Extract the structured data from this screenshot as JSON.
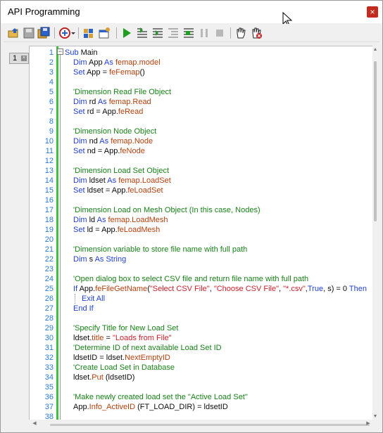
{
  "window": {
    "title": "API Programming",
    "close_label": "×"
  },
  "toolbar": {
    "buttons": [
      "open-icon",
      "save-icon",
      "save-all-icon",
      "reference-icon",
      "dropdown-arrow-icon",
      "build-icon",
      "references-icon",
      "run-icon",
      "step-into-icon",
      "step-over-icon",
      "step-out-icon",
      "run-to-cursor-icon",
      "pause-icon",
      "stop-icon",
      "grab-icon",
      "stop-grab-icon"
    ]
  },
  "tabs": [
    {
      "label": "1",
      "close_label": "×"
    }
  ],
  "editor": {
    "lines": [
      {
        "n": "1",
        "indent": 0,
        "parts": [
          [
            "kw",
            "Sub "
          ],
          [
            "pl",
            "Main"
          ]
        ]
      },
      {
        "n": "2",
        "indent": 1,
        "parts": [
          [
            "kw",
            "Dim "
          ],
          [
            "pl",
            "App "
          ],
          [
            "kw",
            "As "
          ],
          [
            "ob",
            "femap.model"
          ]
        ]
      },
      {
        "n": "3",
        "indent": 1,
        "parts": [
          [
            "kw",
            "Set "
          ],
          [
            "pl",
            "App = "
          ],
          [
            "fn",
            "feFemap"
          ],
          [
            "pl",
            "()"
          ]
        ]
      },
      {
        "n": "4",
        "indent": 0,
        "parts": []
      },
      {
        "n": "5",
        "indent": 1,
        "parts": [
          [
            "cm",
            "'Dimension Read File Object"
          ]
        ]
      },
      {
        "n": "6",
        "indent": 1,
        "parts": [
          [
            "kw",
            "Dim "
          ],
          [
            "pl",
            "rd "
          ],
          [
            "kw",
            "As "
          ],
          [
            "ob",
            "femap.Read"
          ]
        ]
      },
      {
        "n": "7",
        "indent": 1,
        "parts": [
          [
            "kw",
            "Set "
          ],
          [
            "pl",
            "rd = App."
          ],
          [
            "fn",
            "feRead"
          ]
        ]
      },
      {
        "n": "8",
        "indent": 0,
        "parts": []
      },
      {
        "n": "9",
        "indent": 1,
        "parts": [
          [
            "cm",
            "'Dimension Node Object"
          ]
        ]
      },
      {
        "n": "10",
        "indent": 1,
        "parts": [
          [
            "kw",
            "Dim "
          ],
          [
            "pl",
            "nd "
          ],
          [
            "kw",
            "As "
          ],
          [
            "ob",
            "femap.Node"
          ]
        ]
      },
      {
        "n": "11",
        "indent": 1,
        "parts": [
          [
            "kw",
            "Set "
          ],
          [
            "pl",
            "nd = App."
          ],
          [
            "fn",
            "feNode"
          ]
        ]
      },
      {
        "n": "12",
        "indent": 0,
        "parts": []
      },
      {
        "n": "13",
        "indent": 1,
        "parts": [
          [
            "cm",
            "'Dimension Load Set Object"
          ]
        ]
      },
      {
        "n": "14",
        "indent": 1,
        "parts": [
          [
            "kw",
            "Dim "
          ],
          [
            "pl",
            "ldset "
          ],
          [
            "kw",
            "As "
          ],
          [
            "ob",
            "femap.LoadSet"
          ]
        ]
      },
      {
        "n": "15",
        "indent": 1,
        "parts": [
          [
            "kw",
            "Set "
          ],
          [
            "pl",
            "ldset = App."
          ],
          [
            "fn",
            "feLoadSet"
          ]
        ]
      },
      {
        "n": "16",
        "indent": 0,
        "parts": []
      },
      {
        "n": "17",
        "indent": 1,
        "parts": [
          [
            "cm",
            "'Dimension Load on Mesh Object (In this case, Nodes)"
          ]
        ]
      },
      {
        "n": "18",
        "indent": 1,
        "parts": [
          [
            "kw",
            "Dim "
          ],
          [
            "pl",
            "ld "
          ],
          [
            "kw",
            "As "
          ],
          [
            "ob",
            "femap.LoadMesh"
          ]
        ]
      },
      {
        "n": "19",
        "indent": 1,
        "parts": [
          [
            "kw",
            "Set "
          ],
          [
            "pl",
            "ld = App."
          ],
          [
            "fn",
            "feLoadMesh"
          ]
        ]
      },
      {
        "n": "20",
        "indent": 0,
        "parts": []
      },
      {
        "n": "21",
        "indent": 1,
        "parts": [
          [
            "cm",
            "'Dimension variable to store file name with full path"
          ]
        ]
      },
      {
        "n": "22",
        "indent": 1,
        "parts": [
          [
            "kw",
            "Dim "
          ],
          [
            "pl",
            "s "
          ],
          [
            "kw",
            "As String"
          ]
        ]
      },
      {
        "n": "23",
        "indent": 0,
        "parts": []
      },
      {
        "n": "24",
        "indent": 1,
        "parts": [
          [
            "cm",
            "'Open dialog box to select CSV file and return file name with full path"
          ]
        ]
      },
      {
        "n": "25",
        "indent": 1,
        "parts": [
          [
            "kw",
            "If "
          ],
          [
            "pl",
            "App."
          ],
          [
            "fn",
            "feFileGetName"
          ],
          [
            "pl",
            "("
          ],
          [
            "st",
            "\"Select CSV File\""
          ],
          [
            "pl",
            ", "
          ],
          [
            "st",
            "\"Choose CSV File\""
          ],
          [
            "pl",
            ", "
          ],
          [
            "st",
            "\"*.csv\""
          ],
          [
            "pl",
            ","
          ],
          [
            "kw",
            "True"
          ],
          [
            "pl",
            ", s) = 0 "
          ],
          [
            "kw",
            "Then"
          ]
        ]
      },
      {
        "n": "26",
        "indent": 2,
        "parts": [
          [
            "kw",
            "Exit All"
          ]
        ]
      },
      {
        "n": "27",
        "indent": 1,
        "parts": [
          [
            "kw",
            "End If"
          ]
        ]
      },
      {
        "n": "28",
        "indent": 0,
        "parts": []
      },
      {
        "n": "29",
        "indent": 1,
        "parts": [
          [
            "cm",
            "'Specify Title for New Load Set"
          ]
        ]
      },
      {
        "n": "30",
        "indent": 1,
        "parts": [
          [
            "pl",
            "ldset."
          ],
          [
            "fn",
            "title"
          ],
          [
            "pl",
            " = "
          ],
          [
            "st",
            "\"Loads from File\""
          ]
        ]
      },
      {
        "n": "31",
        "indent": 1,
        "parts": [
          [
            "cm",
            "'Determine ID of next available Load Set ID"
          ]
        ]
      },
      {
        "n": "32",
        "indent": 1,
        "parts": [
          [
            "pl",
            "ldsetID = ldset."
          ],
          [
            "fn",
            "NextEmptyID"
          ]
        ]
      },
      {
        "n": "33",
        "indent": 1,
        "parts": [
          [
            "cm",
            "'Create Load Set in Database"
          ]
        ]
      },
      {
        "n": "34",
        "indent": 1,
        "parts": [
          [
            "pl",
            "ldset."
          ],
          [
            "fn",
            "Put"
          ],
          [
            "pl",
            " (ldsetID)"
          ]
        ]
      },
      {
        "n": "35",
        "indent": 0,
        "parts": []
      },
      {
        "n": "36",
        "indent": 1,
        "parts": [
          [
            "cm",
            "'Make newly created load set the \"Active Load Set\""
          ]
        ]
      },
      {
        "n": "37",
        "indent": 1,
        "parts": [
          [
            "pl",
            "App."
          ],
          [
            "fn",
            "Info_ActiveID"
          ],
          [
            "pl",
            " (FT_LOAD_DIR) = ldsetID"
          ]
        ]
      },
      {
        "n": "38",
        "indent": 0,
        "parts": []
      }
    ]
  }
}
